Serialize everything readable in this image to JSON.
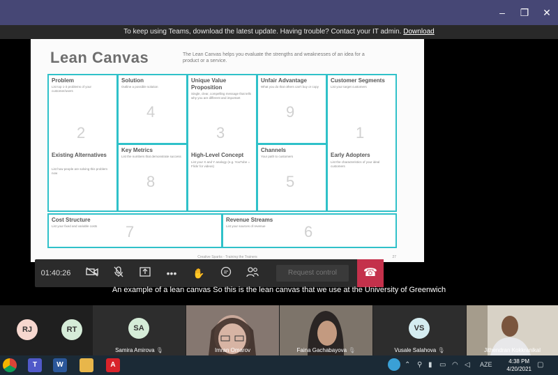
{
  "window": {
    "minimize": "–",
    "restore": "❐",
    "close": "✕"
  },
  "banner": {
    "text": "To keep using Teams, download the latest update. Having trouble? Contact your IT admin.",
    "link": "Download"
  },
  "slide": {
    "title": "Lean Canvas",
    "description": "The Lean Canvas helps you evaluate the strengths and weaknesses of an idea for a product or a service.",
    "cells": {
      "problem": {
        "heading": "Problem",
        "sub": "List top 1-3 problems of your customer/users",
        "num": "2"
      },
      "existing": {
        "heading": "Existing Alternatives",
        "sub": "List how people are solving this problem now"
      },
      "solution": {
        "heading": "Solution",
        "sub": "Outline a possible solution",
        "num": "4"
      },
      "metrics": {
        "heading": "Key Metrics",
        "sub": "List the numbers that demonstrate success",
        "num": "8"
      },
      "uvp": {
        "heading": "Unique Value Proposition",
        "sub": "Single, clear, compelling message that tells why you are different and important",
        "num": "3"
      },
      "concept": {
        "heading": "High-Level Concept",
        "sub": "List your X and Y analogy (e.g. YouTube = Flickr for videos)"
      },
      "advantage": {
        "heading": "Unfair Advantage",
        "sub": "What you do that others can't buy or copy",
        "num": "9"
      },
      "channels": {
        "heading": "Channels",
        "sub": "Your path to customers",
        "num": "5"
      },
      "segments": {
        "heading": "Customer Segments",
        "sub": "List your target customers",
        "num": "1"
      },
      "adopters": {
        "heading": "Early Adopters",
        "sub": "List the characteristics of your ideal customers"
      },
      "cost": {
        "heading": "Cost Structure",
        "sub": "List your fixed and variable costs",
        "num": "7"
      },
      "revenue": {
        "heading": "Revenue Streams",
        "sub": "List your sources of revenue",
        "num": "6"
      }
    },
    "footer": "Creative Sparks - Training the Trainers",
    "page": "27"
  },
  "toolbar": {
    "timer": "01:40:26",
    "request_control": "Request control",
    "hangup": "☎"
  },
  "caption": "An example of a lean canvas So this is the lean canvas that we use at the University of Greenwich",
  "participants": [
    {
      "initials": "RJ",
      "color": "#f6d7cf"
    },
    {
      "initials": "RT",
      "color": "#d5ecd8"
    },
    {
      "initials": "SA",
      "name": "Samira Amirova",
      "color": "#d5ecd8"
    },
    {
      "name": "Imran Omarov"
    },
    {
      "name": "Faina Gachabayova"
    },
    {
      "initials": "VS",
      "name": "Vusale Salahova",
      "color": "#d4ecf0"
    },
    {
      "name": "Jithendran Kokkranikal"
    }
  ],
  "mic_icon": "🎙",
  "taskbar": {
    "word": "W",
    "pdf": "A",
    "language": "AZE",
    "time": "4:38 PM",
    "date": "4/20/2021"
  }
}
